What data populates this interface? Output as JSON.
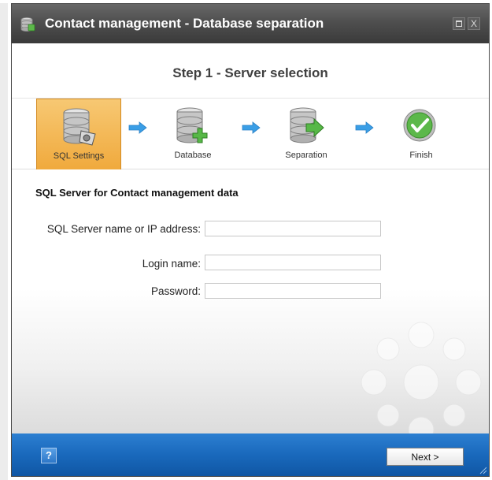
{
  "window": {
    "title": "Contact management - Database separation",
    "icon": "database-icon",
    "controls": {
      "maximize": "maximize-icon",
      "close": "X"
    }
  },
  "wizard": {
    "step_title": "Step 1 - Server selection",
    "steps": [
      {
        "label": "SQL Settings",
        "icon": "sql-settings-icon",
        "active": true
      },
      {
        "label": "Database",
        "icon": "database-add-icon",
        "active": false
      },
      {
        "label": "Separation",
        "icon": "database-separation-icon",
        "active": false
      },
      {
        "label": "Finish",
        "icon": "checkmark-icon",
        "active": false
      }
    ]
  },
  "form": {
    "section_title": "SQL Server for Contact management data",
    "fields": {
      "server": {
        "label": "SQL Server name or IP address:",
        "value": ""
      },
      "login": {
        "label": "Login name:",
        "value": ""
      },
      "password": {
        "label": "Password:",
        "value": ""
      }
    }
  },
  "footer": {
    "help_label": "?",
    "next_label": "Next >"
  },
  "colors": {
    "titlebar": "#4f4f4f",
    "active_step": "#f0a93c",
    "footer": "#1968bb",
    "arrow": "#3a9ee6"
  }
}
